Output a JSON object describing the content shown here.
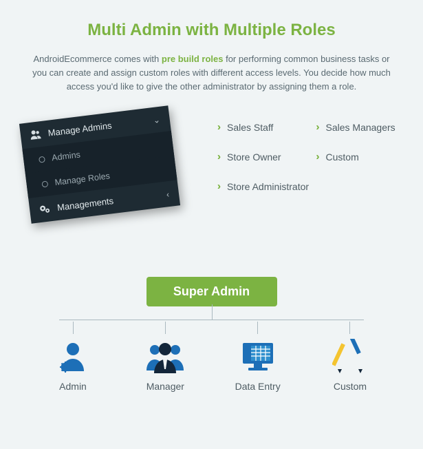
{
  "title": "Multi Admin with Multiple Roles",
  "subtitle_pre": "AndroidEcommerce comes with ",
  "subtitle_hl": "pre build roles",
  "subtitle_post": " for performing common business tasks or you can create and assign custom roles with different access levels. You decide how much access you'd like to give the other administrator by assigning them a role.",
  "menu": {
    "header": "Manage Admins",
    "items": [
      "Admins",
      "Manage Roles"
    ],
    "footer": "Managements"
  },
  "roles": [
    "Sales Staff",
    "Sales Managers",
    "Store Owner",
    "Custom",
    "Store Administrator"
  ],
  "super_label": "Super Admin",
  "nodes": [
    {
      "label": "Admin"
    },
    {
      "label": "Manager"
    },
    {
      "label": "Data Entry"
    },
    {
      "label": "Custom"
    }
  ]
}
